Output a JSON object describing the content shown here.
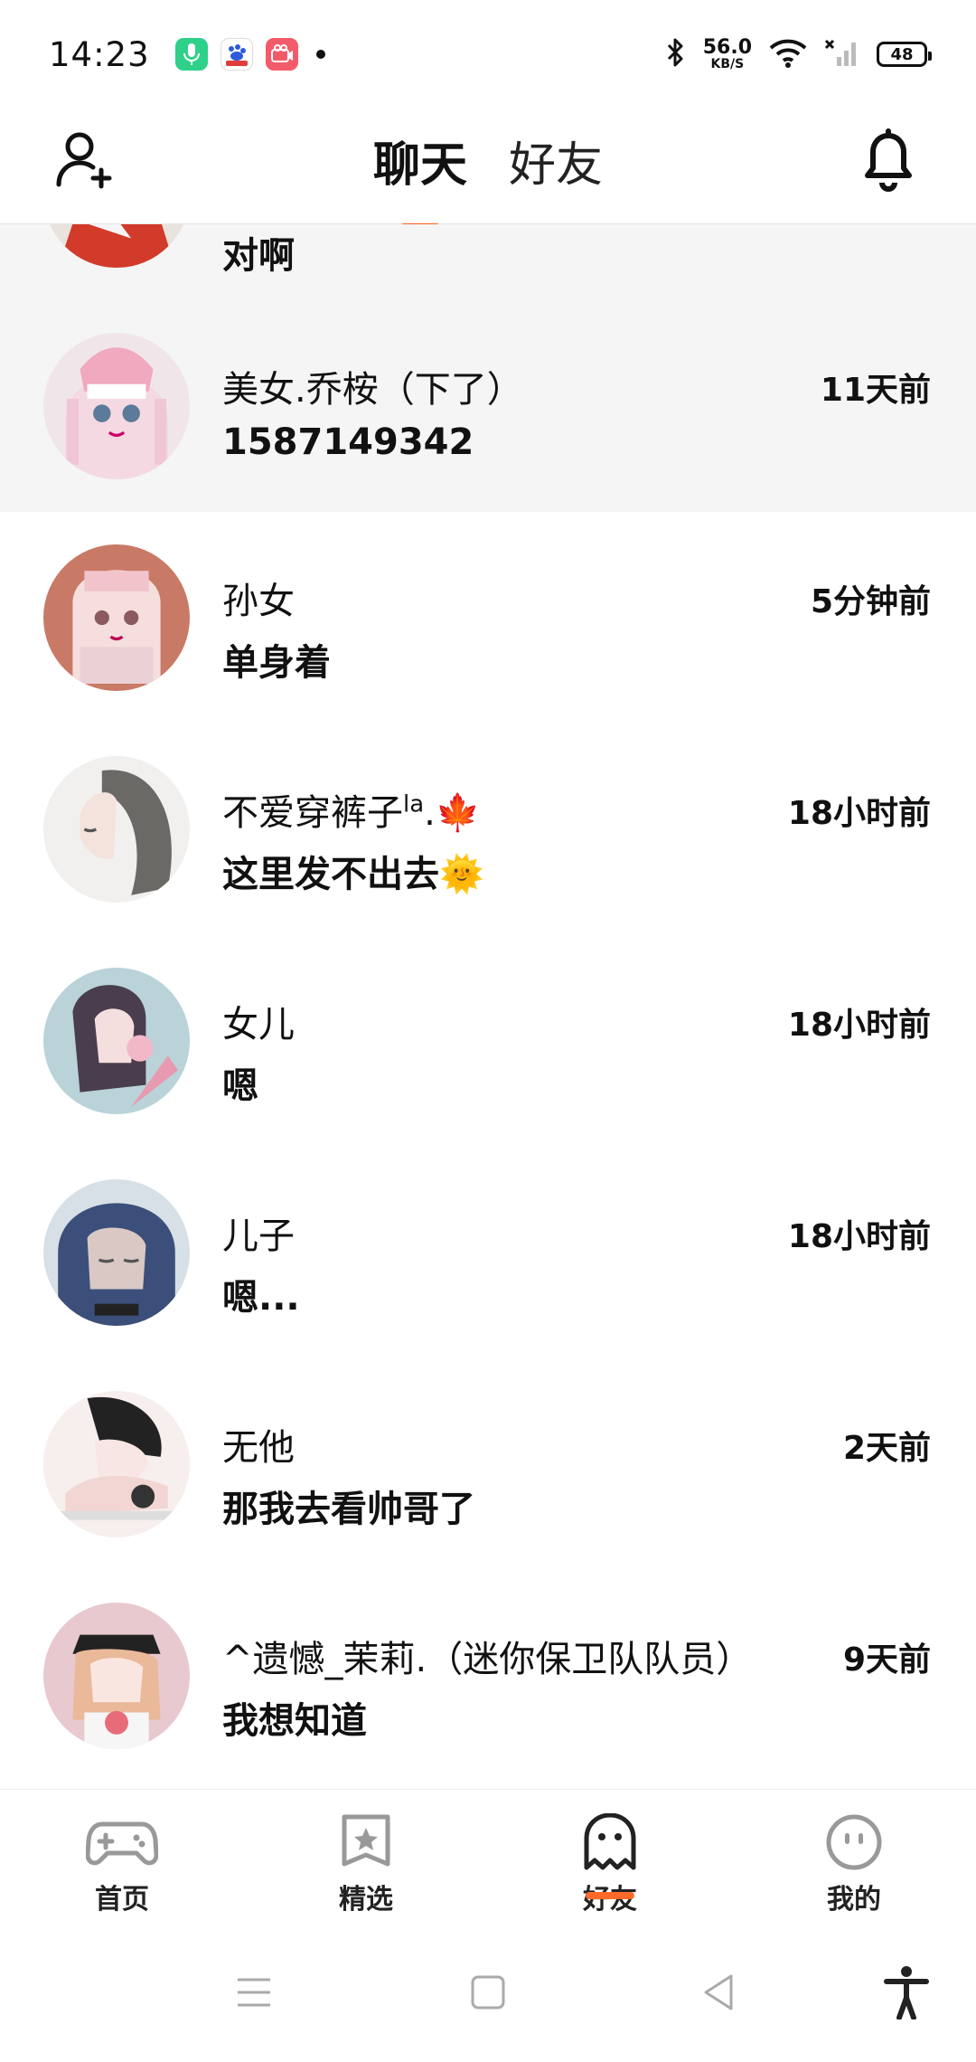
{
  "status_bar": {
    "time": "14:23",
    "net_speed_value": "56.0",
    "net_speed_unit": "KB/S",
    "battery": "48",
    "icons": [
      "mic-app-icon",
      "baidu-app-icon",
      "camera-app-icon",
      "notification-dot",
      "bluetooth-icon",
      "wifi-icon",
      "signal-icon",
      "battery-icon"
    ]
  },
  "header": {
    "tabs": [
      {
        "label": "聊天",
        "active": true
      },
      {
        "label": "好友",
        "active": false
      }
    ],
    "left_icon": "add-friend-icon",
    "right_icon": "bell-icon"
  },
  "chats": [
    {
      "name": "",
      "message": "对啊",
      "time": ""
    },
    {
      "name": "美女.乔桉（下了）",
      "message": "1587149342",
      "time": "11天前"
    },
    {
      "name": "孙女",
      "message": "单身着",
      "time": "5分钟前"
    },
    {
      "name": "不爱穿裤子",
      "name_sup": "la",
      "name_suffix": ".🍁",
      "message": "这里发不出去🌞",
      "time": "18小时前"
    },
    {
      "name": "女儿",
      "message": "嗯",
      "time": "18小时前"
    },
    {
      "name": "儿子",
      "message": "嗯...",
      "time": "18小时前"
    },
    {
      "name": "无他",
      "message": "那我去看帅哥了",
      "time": "2天前"
    },
    {
      "name": "^遗憾_茉莉.（迷你保卫队队员）",
      "message": "我想知道",
      "time": "9天前"
    }
  ],
  "bottom_nav": [
    {
      "label": "首页",
      "icon": "gamepad-icon",
      "active": false
    },
    {
      "label": "精选",
      "icon": "star-bookmark-icon",
      "active": false
    },
    {
      "label": "好友",
      "icon": "ghost-icon",
      "active": true
    },
    {
      "label": "我的",
      "icon": "face-icon",
      "active": false
    }
  ],
  "colors": {
    "accent": "#ff5a1f",
    "highlight_row": "#f5f5f5",
    "divider": "#e6e6e6"
  }
}
